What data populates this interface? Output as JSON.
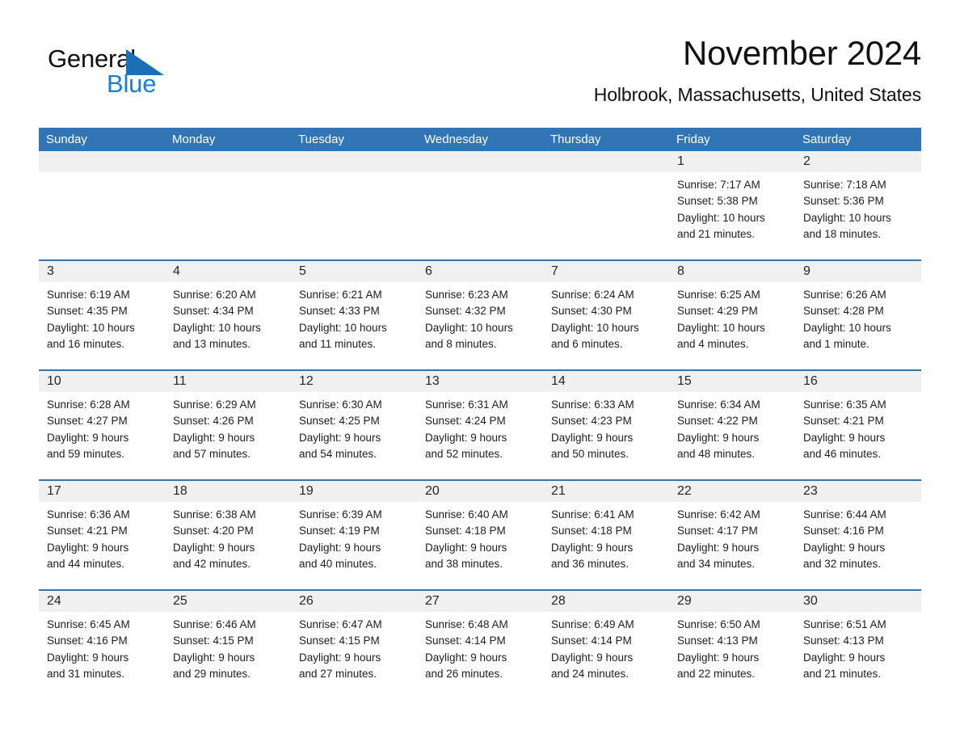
{
  "brand": {
    "name_part1": "General",
    "name_part2": "Blue",
    "triangle_icon": "blue-triangle-logo-mark",
    "accent_color": "#1a6fb5",
    "blue_text_color": "#1a7fd4"
  },
  "header": {
    "title": "November 2024",
    "subtitle": "Holbrook, Massachusetts, United States"
  },
  "theme": {
    "header_bar_color": "#3275b4",
    "daynum_band_color": "#f0f0f0",
    "week_rule_color": "#3275b4",
    "page_background": "#ffffff",
    "text_color": "#1d1d1d"
  },
  "weekdays": [
    "Sunday",
    "Monday",
    "Tuesday",
    "Wednesday",
    "Thursday",
    "Friday",
    "Saturday"
  ],
  "weeks": [
    {
      "days": [
        {
          "num": "",
          "empty": true,
          "lines": [
            "",
            "",
            "",
            ""
          ]
        },
        {
          "num": "",
          "empty": true,
          "lines": [
            "",
            "",
            "",
            ""
          ]
        },
        {
          "num": "",
          "empty": true,
          "lines": [
            "",
            "",
            "",
            ""
          ]
        },
        {
          "num": "",
          "empty": true,
          "lines": [
            "",
            "",
            "",
            ""
          ]
        },
        {
          "num": "",
          "empty": true,
          "lines": [
            "",
            "",
            "",
            ""
          ]
        },
        {
          "num": "1",
          "empty": false,
          "lines": [
            "Sunrise: 7:17 AM",
            "Sunset: 5:38 PM",
            "Daylight: 10 hours",
            "and 21 minutes."
          ]
        },
        {
          "num": "2",
          "empty": false,
          "lines": [
            "Sunrise: 7:18 AM",
            "Sunset: 5:36 PM",
            "Daylight: 10 hours",
            "and 18 minutes."
          ]
        }
      ]
    },
    {
      "days": [
        {
          "num": "3",
          "empty": false,
          "lines": [
            "Sunrise: 6:19 AM",
            "Sunset: 4:35 PM",
            "Daylight: 10 hours",
            "and 16 minutes."
          ]
        },
        {
          "num": "4",
          "empty": false,
          "lines": [
            "Sunrise: 6:20 AM",
            "Sunset: 4:34 PM",
            "Daylight: 10 hours",
            "and 13 minutes."
          ]
        },
        {
          "num": "5",
          "empty": false,
          "lines": [
            "Sunrise: 6:21 AM",
            "Sunset: 4:33 PM",
            "Daylight: 10 hours",
            "and 11 minutes."
          ]
        },
        {
          "num": "6",
          "empty": false,
          "lines": [
            "Sunrise: 6:23 AM",
            "Sunset: 4:32 PM",
            "Daylight: 10 hours",
            "and 8 minutes."
          ]
        },
        {
          "num": "7",
          "empty": false,
          "lines": [
            "Sunrise: 6:24 AM",
            "Sunset: 4:30 PM",
            "Daylight: 10 hours",
            "and 6 minutes."
          ]
        },
        {
          "num": "8",
          "empty": false,
          "lines": [
            "Sunrise: 6:25 AM",
            "Sunset: 4:29 PM",
            "Daylight: 10 hours",
            "and 4 minutes."
          ]
        },
        {
          "num": "9",
          "empty": false,
          "lines": [
            "Sunrise: 6:26 AM",
            "Sunset: 4:28 PM",
            "Daylight: 10 hours",
            "and 1 minute."
          ]
        }
      ]
    },
    {
      "days": [
        {
          "num": "10",
          "empty": false,
          "lines": [
            "Sunrise: 6:28 AM",
            "Sunset: 4:27 PM",
            "Daylight: 9 hours",
            "and 59 minutes."
          ]
        },
        {
          "num": "11",
          "empty": false,
          "lines": [
            "Sunrise: 6:29 AM",
            "Sunset: 4:26 PM",
            "Daylight: 9 hours",
            "and 57 minutes."
          ]
        },
        {
          "num": "12",
          "empty": false,
          "lines": [
            "Sunrise: 6:30 AM",
            "Sunset: 4:25 PM",
            "Daylight: 9 hours",
            "and 54 minutes."
          ]
        },
        {
          "num": "13",
          "empty": false,
          "lines": [
            "Sunrise: 6:31 AM",
            "Sunset: 4:24 PM",
            "Daylight: 9 hours",
            "and 52 minutes."
          ]
        },
        {
          "num": "14",
          "empty": false,
          "lines": [
            "Sunrise: 6:33 AM",
            "Sunset: 4:23 PM",
            "Daylight: 9 hours",
            "and 50 minutes."
          ]
        },
        {
          "num": "15",
          "empty": false,
          "lines": [
            "Sunrise: 6:34 AM",
            "Sunset: 4:22 PM",
            "Daylight: 9 hours",
            "and 48 minutes."
          ]
        },
        {
          "num": "16",
          "empty": false,
          "lines": [
            "Sunrise: 6:35 AM",
            "Sunset: 4:21 PM",
            "Daylight: 9 hours",
            "and 46 minutes."
          ]
        }
      ]
    },
    {
      "days": [
        {
          "num": "17",
          "empty": false,
          "lines": [
            "Sunrise: 6:36 AM",
            "Sunset: 4:21 PM",
            "Daylight: 9 hours",
            "and 44 minutes."
          ]
        },
        {
          "num": "18",
          "empty": false,
          "lines": [
            "Sunrise: 6:38 AM",
            "Sunset: 4:20 PM",
            "Daylight: 9 hours",
            "and 42 minutes."
          ]
        },
        {
          "num": "19",
          "empty": false,
          "lines": [
            "Sunrise: 6:39 AM",
            "Sunset: 4:19 PM",
            "Daylight: 9 hours",
            "and 40 minutes."
          ]
        },
        {
          "num": "20",
          "empty": false,
          "lines": [
            "Sunrise: 6:40 AM",
            "Sunset: 4:18 PM",
            "Daylight: 9 hours",
            "and 38 minutes."
          ]
        },
        {
          "num": "21",
          "empty": false,
          "lines": [
            "Sunrise: 6:41 AM",
            "Sunset: 4:18 PM",
            "Daylight: 9 hours",
            "and 36 minutes."
          ]
        },
        {
          "num": "22",
          "empty": false,
          "lines": [
            "Sunrise: 6:42 AM",
            "Sunset: 4:17 PM",
            "Daylight: 9 hours",
            "and 34 minutes."
          ]
        },
        {
          "num": "23",
          "empty": false,
          "lines": [
            "Sunrise: 6:44 AM",
            "Sunset: 4:16 PM",
            "Daylight: 9 hours",
            "and 32 minutes."
          ]
        }
      ]
    },
    {
      "days": [
        {
          "num": "24",
          "empty": false,
          "lines": [
            "Sunrise: 6:45 AM",
            "Sunset: 4:16 PM",
            "Daylight: 9 hours",
            "and 31 minutes."
          ]
        },
        {
          "num": "25",
          "empty": false,
          "lines": [
            "Sunrise: 6:46 AM",
            "Sunset: 4:15 PM",
            "Daylight: 9 hours",
            "and 29 minutes."
          ]
        },
        {
          "num": "26",
          "empty": false,
          "lines": [
            "Sunrise: 6:47 AM",
            "Sunset: 4:15 PM",
            "Daylight: 9 hours",
            "and 27 minutes."
          ]
        },
        {
          "num": "27",
          "empty": false,
          "lines": [
            "Sunrise: 6:48 AM",
            "Sunset: 4:14 PM",
            "Daylight: 9 hours",
            "and 26 minutes."
          ]
        },
        {
          "num": "28",
          "empty": false,
          "lines": [
            "Sunrise: 6:49 AM",
            "Sunset: 4:14 PM",
            "Daylight: 9 hours",
            "and 24 minutes."
          ]
        },
        {
          "num": "29",
          "empty": false,
          "lines": [
            "Sunrise: 6:50 AM",
            "Sunset: 4:13 PM",
            "Daylight: 9 hours",
            "and 22 minutes."
          ]
        },
        {
          "num": "30",
          "empty": false,
          "lines": [
            "Sunrise: 6:51 AM",
            "Sunset: 4:13 PM",
            "Daylight: 9 hours",
            "and 21 minutes."
          ]
        }
      ]
    }
  ]
}
